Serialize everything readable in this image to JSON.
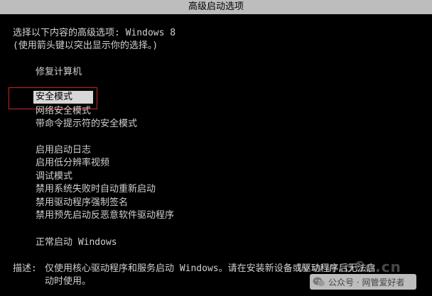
{
  "title": "高级启动选项",
  "prompt": {
    "line1": "选择以下内容的高级选项: Windows 8",
    "line2": "(使用箭头键以突出显示你的选择。)"
  },
  "options": {
    "repair": "修复计算机",
    "safe_mode": "安全模式",
    "safe_mode_network": "网络安全模式",
    "safe_mode_cmd": "带命令提示符的安全模式",
    "boot_log": "启用启动日志",
    "low_res": "启用低分辨率视频",
    "debug": "调试模式",
    "disable_restart": "禁用系统失败时自动重新启动",
    "disable_sig": "禁用驱动程序强制签名",
    "disable_elam": "禁用预先启动反恶意软件驱动程序",
    "normal": "正常启动 Windows"
  },
  "selected_option": "安全模式",
  "description": {
    "label": "描述:",
    "line1": "仅使用核心驱动程序和服务启动 Windows。请在安装新设备或驱动程序后无法启",
    "line2": "动时使用。"
  },
  "watermark": {
    "url": "www.o6o.cn",
    "account": "公众号 · 网管爱好者"
  },
  "colors": {
    "background": "#000000",
    "text": "#d0d0d0",
    "title_bar": "#bdbdbd",
    "selection": "#d8d8d8",
    "annotation_box": "#c62828"
  }
}
